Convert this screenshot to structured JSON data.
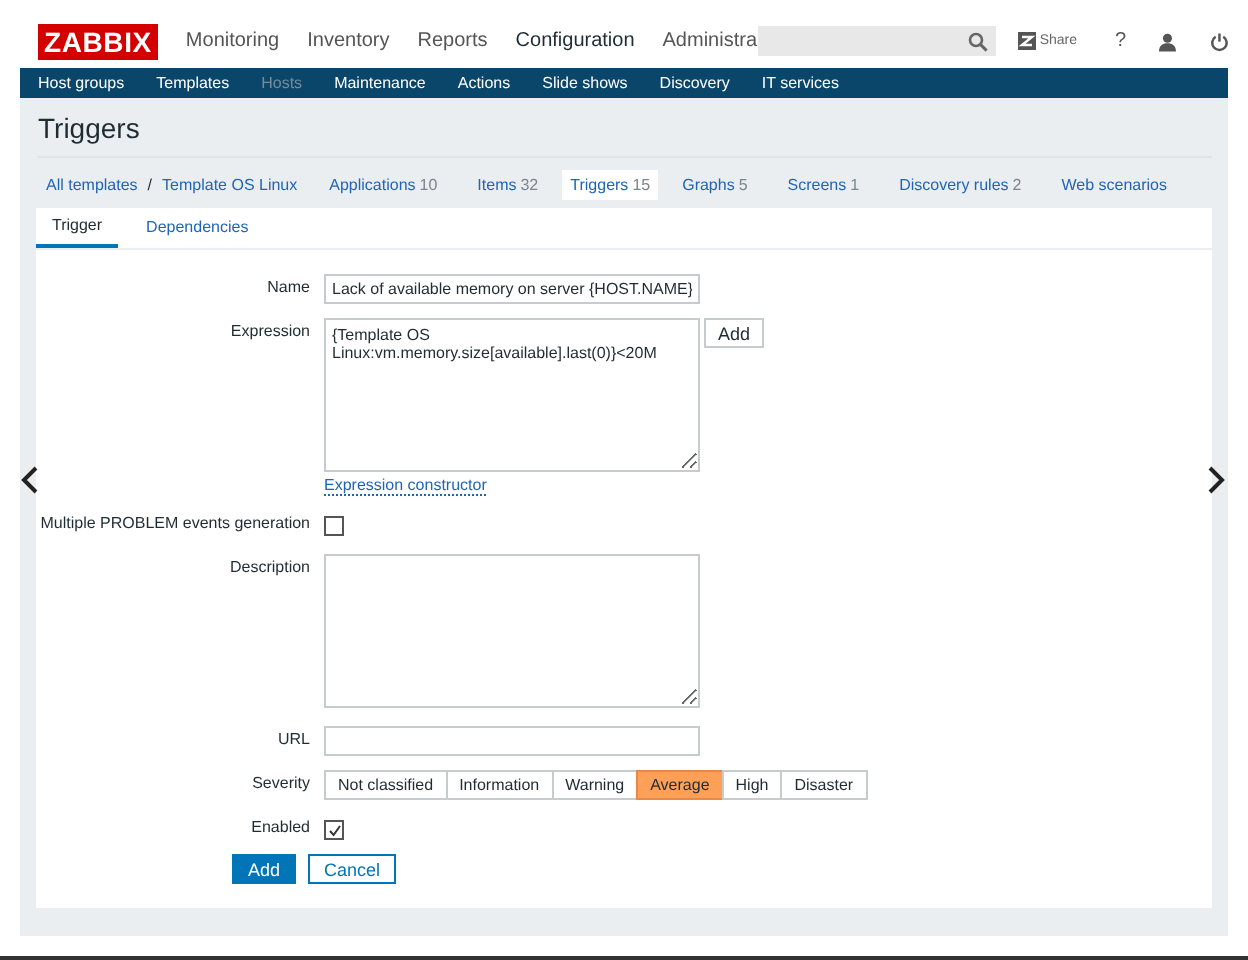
{
  "logo": "ZABBIX",
  "main_menu": [
    {
      "label": "Monitoring",
      "selected": false
    },
    {
      "label": "Inventory",
      "selected": false
    },
    {
      "label": "Reports",
      "selected": false
    },
    {
      "label": "Configuration",
      "selected": true
    },
    {
      "label": "Administra",
      "selected": false
    }
  ],
  "share": "Share",
  "help": "?",
  "sub_menu": [
    {
      "label": "Host groups",
      "selected": false
    },
    {
      "label": "Templates",
      "selected": false
    },
    {
      "label": "Hosts",
      "selected": true
    },
    {
      "label": "Maintenance",
      "selected": false
    },
    {
      "label": "Actions",
      "selected": false
    },
    {
      "label": "Slide shows",
      "selected": false
    },
    {
      "label": "Discovery",
      "selected": false
    },
    {
      "label": "IT services",
      "selected": false
    }
  ],
  "page_title": "Triggers",
  "breadcrumbs": [
    {
      "label": "All templates"
    },
    {
      "label": "Template OS Linux"
    }
  ],
  "breadcrumb_separator": "/",
  "object_tabs": [
    {
      "label": "Applications",
      "count": "10",
      "selected": false
    },
    {
      "label": "Items",
      "count": "32",
      "selected": false
    },
    {
      "label": "Triggers",
      "count": "15",
      "selected": true
    },
    {
      "label": "Graphs",
      "count": "5",
      "selected": false
    },
    {
      "label": "Screens",
      "count": "1",
      "selected": false
    },
    {
      "label": "Discovery rules",
      "count": "2",
      "selected": false
    },
    {
      "label": "Web scenarios",
      "selected": false
    }
  ],
  "form_tabs": [
    {
      "label": "Trigger",
      "selected": true
    },
    {
      "label": "Dependencies",
      "selected": false
    }
  ],
  "form": {
    "name_label": "Name",
    "name_value": "Lack of available memory on server {HOST.NAME}",
    "expression_label": "Expression",
    "expression_value": "{Template OS\nLinux:vm.memory.size[available].last(0)}<20M",
    "expression_add": "Add",
    "expression_constructor": "Expression constructor",
    "multiple_label": "Multiple PROBLEM events generation",
    "multiple_checked": false,
    "description_label": "Description",
    "url_label": "URL",
    "severity_label": "Severity",
    "severities": [
      {
        "label": "Not classified",
        "selected": false
      },
      {
        "label": "Information",
        "selected": false
      },
      {
        "label": "Warning",
        "selected": false
      },
      {
        "label": "Average",
        "selected": true
      },
      {
        "label": "High",
        "selected": false
      },
      {
        "label": "Disaster",
        "selected": false
      }
    ],
    "enabled_label": "Enabled",
    "enabled_checked": true,
    "buttons": [
      {
        "label": "Add",
        "kind": "primary"
      },
      {
        "label": "Cancel",
        "kind": "secondary"
      }
    ]
  }
}
